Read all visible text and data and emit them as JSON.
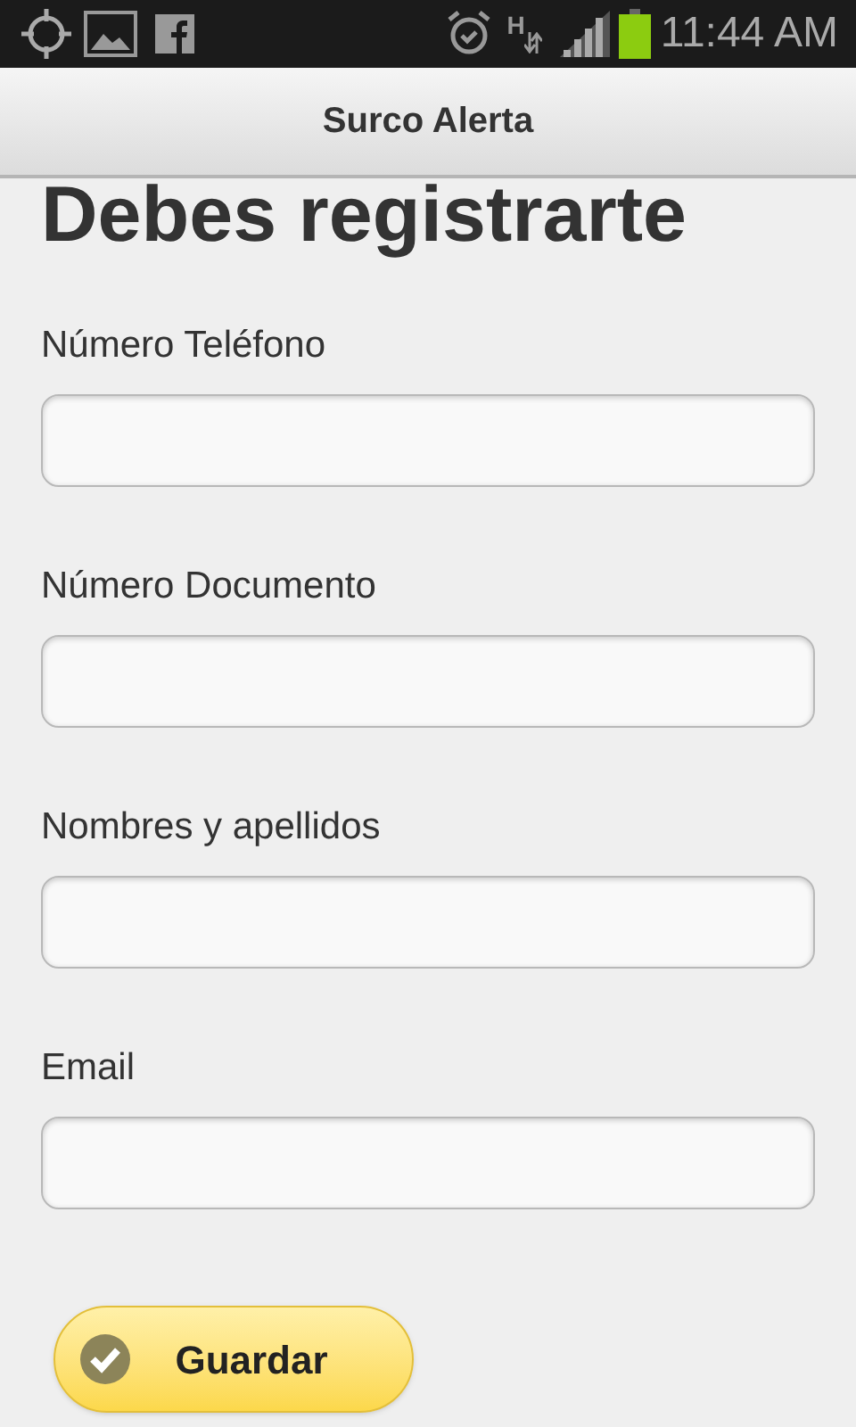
{
  "status_bar": {
    "time": "11:44 AM",
    "network": "H"
  },
  "header": {
    "title": "Surco Alerta"
  },
  "heading": "Debes registrarte",
  "fields": [
    {
      "label": "Número Teléfono"
    },
    {
      "label": "Número Documento"
    },
    {
      "label": "Nombres y apellidos"
    },
    {
      "label": "Email"
    }
  ],
  "button": {
    "label": "Guardar"
  }
}
